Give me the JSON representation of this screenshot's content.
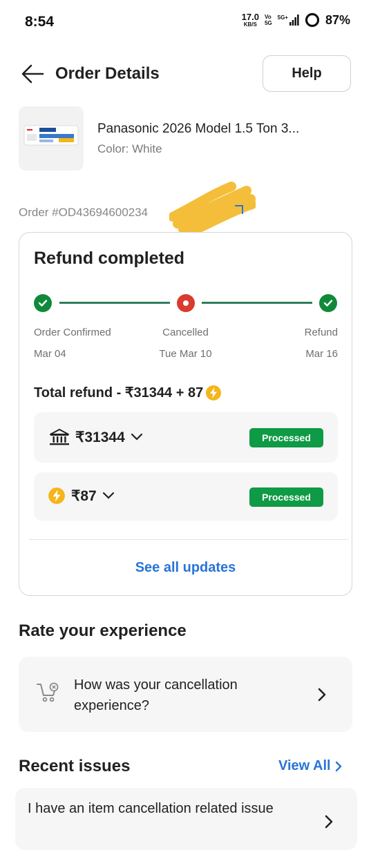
{
  "status_bar": {
    "time": "8:54",
    "speed_value": "17.0",
    "speed_unit": "KB/S",
    "vo_top": "Vo",
    "vo_bottom": "5G",
    "network": "5G+",
    "battery": "87%"
  },
  "header": {
    "title": "Order Details",
    "help_label": "Help"
  },
  "product": {
    "name": "Panasonic 2026 Model 1.5 Ton 3...",
    "color": "Color: White"
  },
  "order_id": "Order #OD43694600234",
  "refund": {
    "title": "Refund completed",
    "steps": [
      {
        "label": "Order Confirmed",
        "date": "Mar 04",
        "status": "done"
      },
      {
        "label": "Cancelled",
        "date": "Tue Mar 10",
        "status": "cancelled"
      },
      {
        "label": "Refund",
        "date": "Mar 16",
        "status": "done"
      }
    ],
    "total_label": "Total refund - ₹31344 + 87",
    "payments": [
      {
        "amount": "₹31344",
        "status": "Processed",
        "icon": "bank-icon"
      },
      {
        "amount": "₹87",
        "status": "Processed",
        "icon": "supercoin-icon"
      }
    ],
    "see_all": "See all updates"
  },
  "rate": {
    "title": "Rate your experience",
    "question": "How was your cancellation experience?"
  },
  "recent": {
    "title": "Recent issues",
    "view_all": "View All",
    "issue_text": "I have an item cancellation related issue"
  },
  "colors": {
    "accent_blue": "#2874d8",
    "success_green": "#0f9a45",
    "cancel_red": "#d93b2e",
    "supercoin_yellow": "#f5b51b"
  }
}
